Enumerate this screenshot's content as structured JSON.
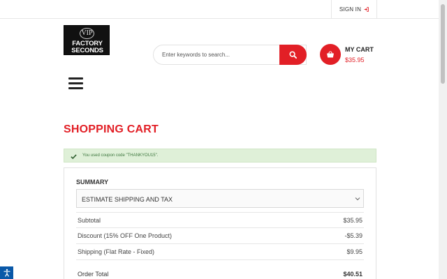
{
  "header": {
    "sign_in_label": "SIGN IN",
    "logo": {
      "badge": "VIP",
      "line1": "FACTORY",
      "line2": "SECONDS"
    },
    "search": {
      "placeholder": "Enter keywords to search...",
      "value": ""
    },
    "cart": {
      "label": "MY CART",
      "total": "$35.95"
    }
  },
  "page": {
    "title": "SHOPPING CART",
    "alert": "You used coupon code \"THANKYOU15\"."
  },
  "summary": {
    "title": "SUMMARY",
    "estimate_label": "ESTIMATE SHIPPING AND TAX",
    "rows": [
      {
        "label": "Subtotal",
        "value": "$35.95"
      },
      {
        "label": "Discount (15% OFF One Product)",
        "value": "-$5.39"
      },
      {
        "label": "Shipping (Flat Rate - Fixed)",
        "value": "$9.95"
      }
    ],
    "total": {
      "label": "Order Total",
      "value": "$40.51"
    }
  },
  "colors": {
    "accent": "#e21f26",
    "alert_bg": "#dff0d8",
    "alert_text": "#3c763d",
    "a11y": "#0a58a8"
  },
  "icons": {
    "sign_in": "sign-in-icon",
    "search": "search-icon",
    "cart": "basket-icon",
    "menu": "hamburger-icon",
    "alert": "check-icon",
    "dropdown": "chevron-down-icon",
    "accessibility": "accessibility-icon"
  }
}
